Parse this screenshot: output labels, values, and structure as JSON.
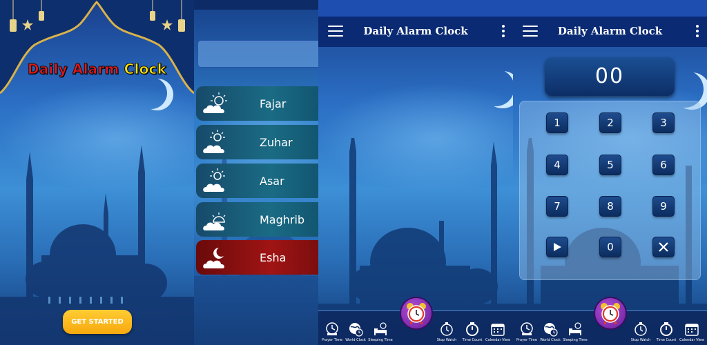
{
  "panel1": {
    "title_part1": "Daily Alarm",
    "title_part2": "Clock",
    "get_started_label": "GET STARTED"
  },
  "panel2": {
    "prayers": [
      {
        "label": "Fajar",
        "icon": "sun-cloud-icon",
        "active": false
      },
      {
        "label": "Zuhar",
        "icon": "sun-cloud-icon",
        "active": false
      },
      {
        "label": "Asar",
        "icon": "sun-cloud-icon",
        "active": false
      },
      {
        "label": "Maghrib",
        "icon": "sun-cloud-icon",
        "active": false
      },
      {
        "label": "Esha",
        "icon": "moon-cloud-icon",
        "active": true
      }
    ]
  },
  "header": {
    "title": "Daily Alarm Clock"
  },
  "bottom_nav": {
    "items": [
      {
        "label": "Prayer Time",
        "icon": "prayer-time-icon"
      },
      {
        "label": "World Clock",
        "icon": "world-clock-icon"
      },
      {
        "label": "Sleeping Time",
        "icon": "sleeping-time-icon"
      },
      {
        "label": "Stop Watch",
        "icon": "stopwatch-icon"
      },
      {
        "label": "Time Count",
        "icon": "timer-icon"
      },
      {
        "label": "Calendar View",
        "icon": "calendar-icon"
      }
    ],
    "center_icon": "alarm-clock-icon"
  },
  "dialpad": {
    "display_value": "00",
    "keys": [
      "1",
      "2",
      "3",
      "4",
      "5",
      "6",
      "7",
      "8",
      "9",
      "play",
      "0",
      "clear"
    ]
  },
  "colors": {
    "header": "#0a2a73",
    "active_row": "#a01414",
    "accent_button": "#f7a90d"
  }
}
